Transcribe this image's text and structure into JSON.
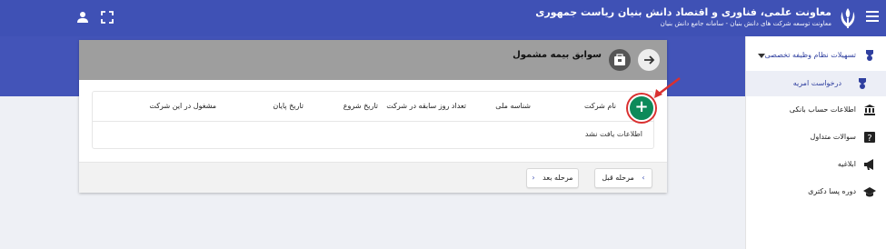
{
  "header": {
    "title": "معاونت علمی، فناوری و اقتصاد دانش بنیان ریاست جمهوری",
    "subtitle": "معاونت توسعه شرکت های دانش بنیان - سامانه جامع دانش بنیان",
    "menu_icon": "hamburger-icon",
    "user_icon": "user-icon",
    "fullscreen_icon": "fullscreen-icon"
  },
  "sidebar": {
    "items": [
      {
        "label": "تسهیلات نظام وظیفه تخصصی",
        "icon": "medal-icon"
      },
      {
        "label": "درخواست امریه",
        "icon": "medal-icon"
      },
      {
        "label": "اطلاعات حساب بانکی",
        "icon": "bank-icon"
      },
      {
        "label": "سوالات متداول",
        "icon": "question-icon"
      },
      {
        "label": "ابلاغیه",
        "icon": "megaphone-icon"
      },
      {
        "label": "دوره پسا دکتری",
        "icon": "graduation-cap-icon"
      }
    ]
  },
  "card": {
    "title": "سوابق بیمه مشمول",
    "columns": [
      "نام شرکت",
      "شناسه ملی",
      "تعداد روز سابقه در شرکت",
      "تاریخ شروع",
      "تاریخ پایان",
      "مشغول در این شرکت"
    ],
    "empty_message": "اطلاعات یافت نشد",
    "add_button": "+",
    "prev_button": "مرحله قبل",
    "next_button": "مرحله بعد"
  },
  "colors": {
    "primary": "#3f51b5",
    "accent": "#0d8a5a",
    "highlight": "#d93030",
    "card_header": "#9e9e9e"
  }
}
